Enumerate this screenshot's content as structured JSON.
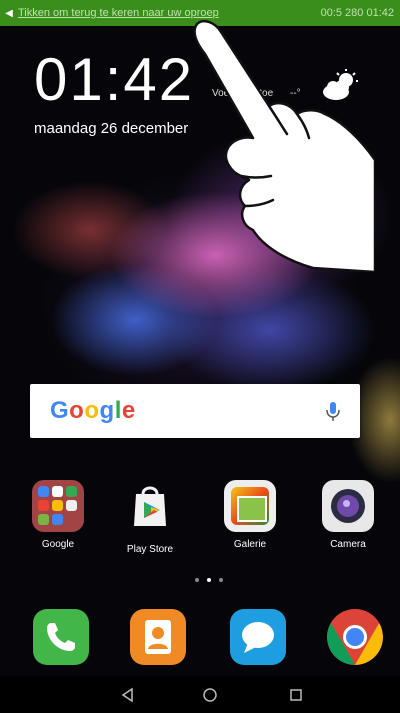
{
  "status_bar": {
    "notification_text": "Tikken om terug te keren naar uw oproep",
    "right_text": "00:5 280 01:42",
    "bar_color": "#3a8f1c"
  },
  "lock_widget": {
    "time": "01:42",
    "location": "Voeg stad toe",
    "temperature": "--°",
    "date": "maandag 26 december",
    "weather_icon": "cloud-sun-icon"
  },
  "search_widget": {
    "logo": "Google",
    "mic_icon": "microphone-icon"
  },
  "apps": [
    {
      "label": "Google",
      "icon": "folder-icon"
    },
    {
      "label": "Play Store",
      "icon": "play-store-icon"
    },
    {
      "label": "Galerie",
      "icon": "gallery-icon"
    },
    {
      "label": "Camera",
      "icon": "camera-icon"
    }
  ],
  "dock": [
    {
      "name": "Telefoon",
      "icon": "phone-icon",
      "color": "#43b649"
    },
    {
      "name": "Contacten",
      "icon": "contacts-icon",
      "color": "#f08a24"
    },
    {
      "name": "Berichten",
      "icon": "messages-icon",
      "color": "#1e9ee0"
    },
    {
      "name": "Chrome",
      "icon": "chrome-icon",
      "color": "#db4437"
    }
  ],
  "page_indicator": {
    "pages": 3,
    "active": 2
  },
  "nav": [
    "back-icon",
    "home-icon",
    "recents-icon"
  ]
}
